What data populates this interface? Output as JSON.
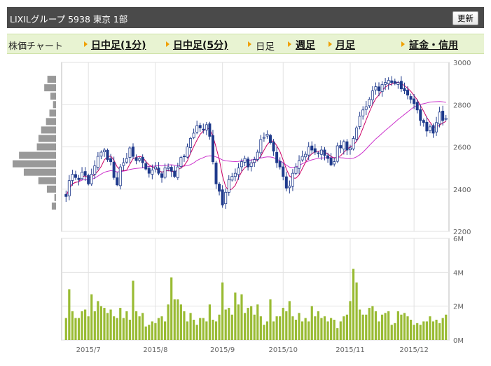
{
  "header": {
    "title": "LIXILグループ 5938 東京 1部",
    "refresh_label": "更新"
  },
  "nav": {
    "chart_label": "株価チャート",
    "links": [
      "日中足(1分)",
      "日中足(5分)",
      "日足",
      "週足",
      "月足",
      "証金・信用"
    ],
    "current": "日足"
  },
  "colors": {
    "up": "#ffffff",
    "down": "#1f3a8c",
    "ma_short": "#cc0066",
    "ma_long": "#cc33cc",
    "volume": "#99bb33",
    "profile": "#999999"
  },
  "chart_data": {
    "type": "candlestick",
    "price_axis": {
      "ticks": [
        "3000",
        "2800",
        "2600",
        "2400",
        "2200"
      ],
      "ylim": [
        2200,
        3000
      ]
    },
    "volume_axis": {
      "ticks": [
        "6M",
        "4M",
        "2M",
        "0M"
      ],
      "ylim": [
        0,
        6000000
      ]
    },
    "x_tick_labels": [
      "2015/7",
      "2015/8",
      "2015/9",
      "2015/10",
      "2015/11",
      "2015/12"
    ],
    "x_tick_index": [
      7,
      28,
      49,
      68,
      89,
      109
    ],
    "closes": [
      2365,
      2440,
      2470,
      2455,
      2445,
      2480,
      2465,
      2425,
      2470,
      2510,
      2555,
      2575,
      2585,
      2540,
      2530,
      2455,
      2420,
      2505,
      2525,
      2545,
      2595,
      2555,
      2535,
      2545,
      2525,
      2495,
      2475,
      2490,
      2505,
      2475,
      2455,
      2500,
      2505,
      2485,
      2460,
      2505,
      2550,
      2555,
      2600,
      2640,
      2665,
      2700,
      2690,
      2680,
      2705,
      2650,
      2530,
      2425,
      2390,
      2325,
      2385,
      2445,
      2460,
      2475,
      2500,
      2530,
      2545,
      2505,
      2525,
      2540,
      2575,
      2635,
      2645,
      2660,
      2620,
      2580,
      2525,
      2505,
      2460,
      2405,
      2415,
      2475,
      2505,
      2535,
      2555,
      2565,
      2600,
      2585,
      2575,
      2570,
      2585,
      2560,
      2545,
      2515,
      2530,
      2605,
      2595,
      2625,
      2585,
      2595,
      2640,
      2690,
      2745,
      2775,
      2790,
      2825,
      2865,
      2885,
      2865,
      2895,
      2905,
      2915,
      2905,
      2900,
      2905,
      2875,
      2865,
      2845,
      2825,
      2805,
      2775,
      2725,
      2715,
      2675,
      2695,
      2665,
      2715,
      2765,
      2725,
      2735
    ],
    "volume_millions": [
      1.3,
      3.0,
      1.7,
      1.3,
      1.3,
      1.7,
      1.8,
      1.4,
      2.7,
      1.7,
      2.3,
      2.0,
      1.9,
      1.6,
      1.8,
      1.4,
      1.3,
      1.9,
      1.3,
      1.7,
      1.2,
      3.5,
      1.7,
      1.4,
      1.6,
      0.8,
      0.9,
      1.1,
      1.0,
      1.3,
      1.4,
      1.1,
      2.1,
      3.7,
      2.4,
      2.4,
      2.1,
      1.7,
      1.1,
      1.6,
      1.2,
      0.9,
      1.3,
      1.3,
      1.1,
      2.1,
      1.2,
      1.1,
      1.5,
      3.4,
      1.8,
      1.9,
      1.5,
      2.8,
      2.1,
      2.7,
      1.6,
      1.9,
      2.0,
      1.5,
      2.1,
      1.4,
      0.9,
      1.1,
      2.4,
      1.1,
      1.4,
      1.4,
      1.9,
      1.7,
      2.3,
      1.4,
      1.2,
      1.6,
      1.1,
      1.3,
      1.1,
      2.0,
      1.4,
      1.7,
      1.3,
      1.4,
      1.1,
      1.3,
      1.2,
      0.7,
      1.1,
      1.4,
      1.5,
      2.3,
      4.2,
      3.4,
      1.8,
      1.5,
      1.5,
      1.9,
      2.0,
      1.7,
      1.1,
      1.5,
      1.6,
      1.7,
      0.9,
      1.0,
      1.7,
      1.5,
      1.6,
      1.4,
      1.2,
      0.9,
      1.0,
      0.9,
      1.1,
      1.1,
      1.4,
      1.1,
      1.2,
      1.0,
      1.3,
      1.5
    ],
    "ma_short_period": 5,
    "ma_long_period": 25
  }
}
